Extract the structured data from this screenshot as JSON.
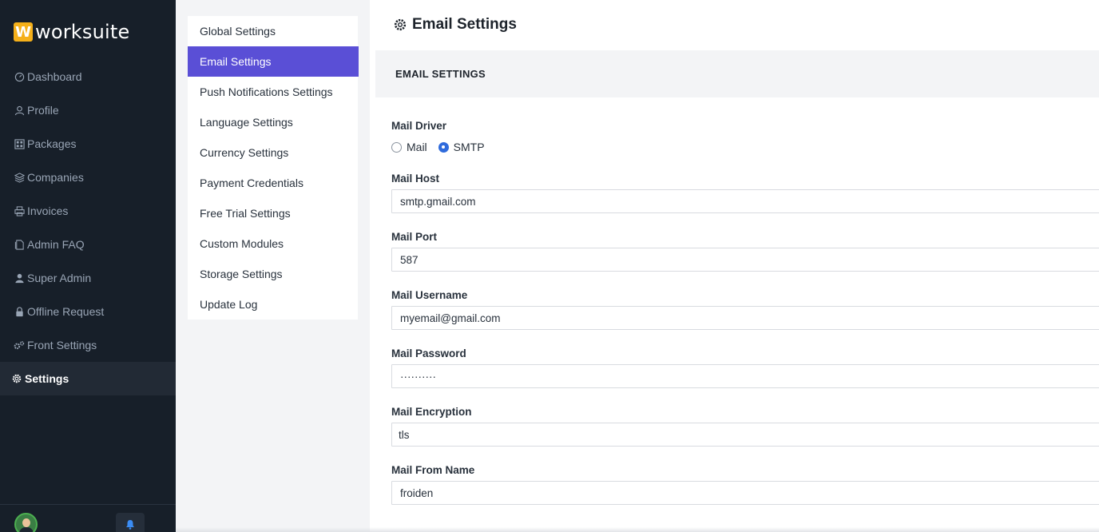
{
  "brand": {
    "mark": "W",
    "name": "worksuite",
    "accent": "#f5b01a"
  },
  "sidebar": {
    "items": [
      {
        "label": "Dashboard",
        "icon": "dashboard-icon"
      },
      {
        "label": "Profile",
        "icon": "user-icon"
      },
      {
        "label": "Packages",
        "icon": "grid-icon"
      },
      {
        "label": "Companies",
        "icon": "layers-icon"
      },
      {
        "label": "Invoices",
        "icon": "printer-icon"
      },
      {
        "label": "Admin FAQ",
        "icon": "file-icon"
      },
      {
        "label": "Super Admin",
        "icon": "user-solid-icon"
      },
      {
        "label": "Offline Request",
        "icon": "lock-icon"
      },
      {
        "label": "Front Settings",
        "icon": "cogs-icon"
      },
      {
        "label": "Settings",
        "icon": "gear-icon",
        "active": true
      }
    ]
  },
  "submenu": {
    "items": [
      "Global Settings",
      "Email Settings",
      "Push Notifications Settings",
      "Language Settings",
      "Currency Settings",
      "Payment Credentials",
      "Free Trial Settings",
      "Custom Modules",
      "Storage Settings",
      "Update Log"
    ],
    "active_index": 1,
    "active_color": "#5a4fd6"
  },
  "page": {
    "title": "Email Settings",
    "section_header": "EMAIL SETTINGS"
  },
  "form": {
    "mail_driver": {
      "label": "Mail Driver",
      "options": [
        "Mail",
        "SMTP"
      ],
      "selected": "SMTP"
    },
    "mail_host": {
      "label": "Mail Host",
      "value": "smtp.gmail.com"
    },
    "mail_port": {
      "label": "Mail Port",
      "value": "587"
    },
    "mail_username": {
      "label": "Mail Username",
      "value": "myemail@gmail.com"
    },
    "mail_password": {
      "label": "Mail Password",
      "value": "··········"
    },
    "mail_encryption": {
      "label": "Mail Encryption",
      "value": "tls"
    },
    "mail_from_name": {
      "label": "Mail From Name",
      "value": "froiden"
    }
  }
}
